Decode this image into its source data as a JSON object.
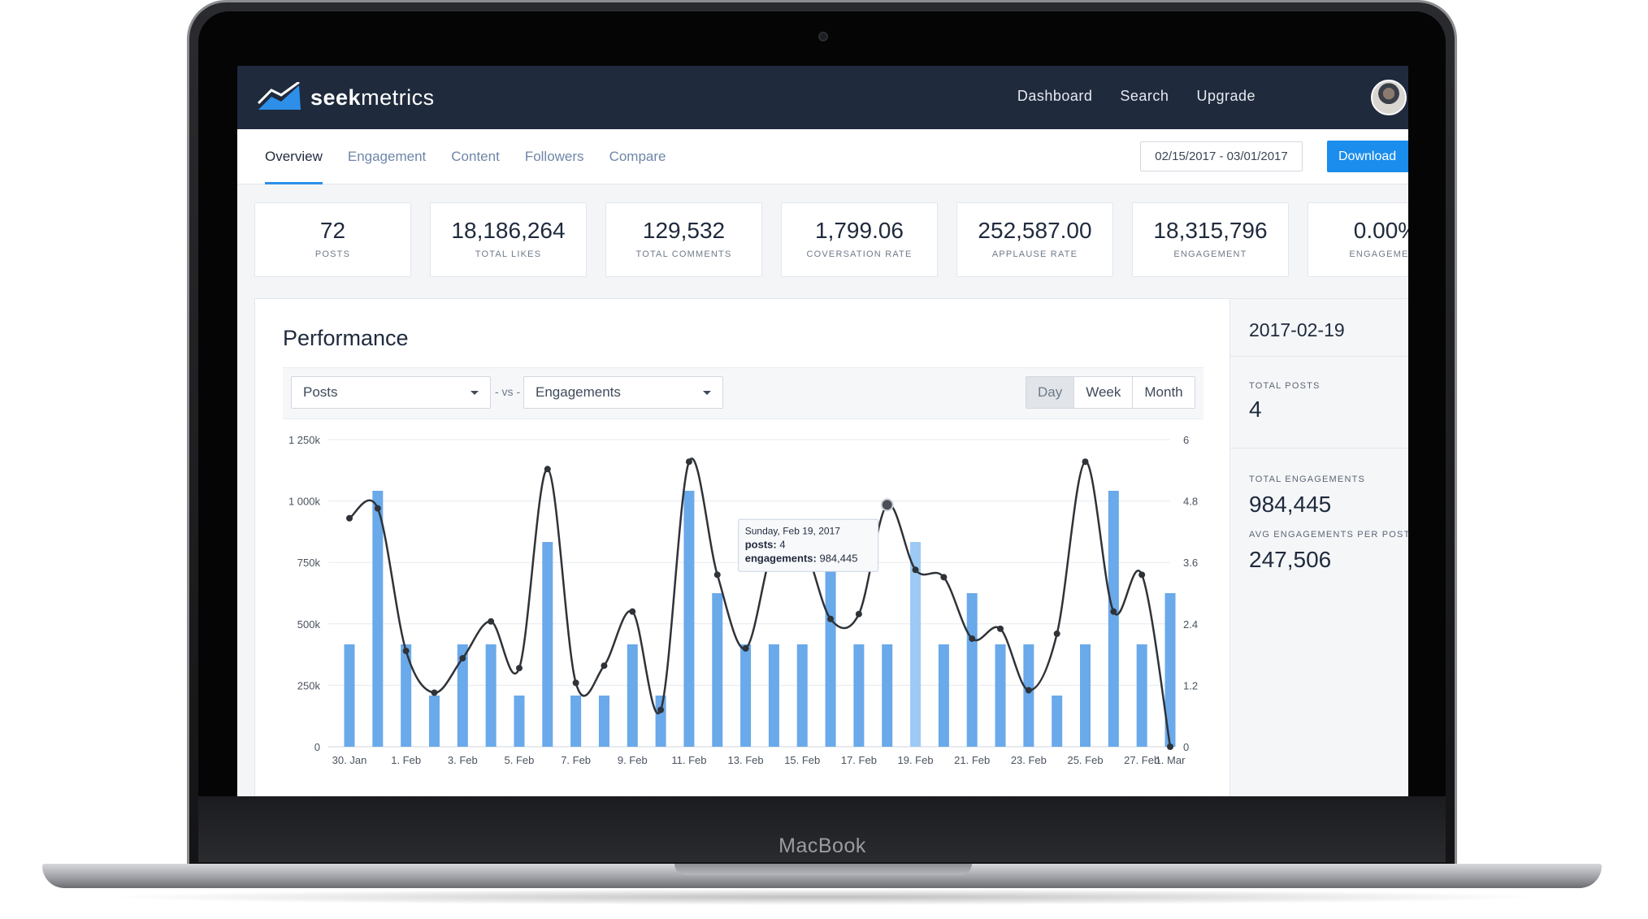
{
  "device": {
    "brand_label": "MacBook"
  },
  "app": {
    "logo_bold": "seek",
    "logo_light": "metrics"
  },
  "topnav": {
    "links": [
      "Dashboard",
      "Search",
      "Upgrade"
    ]
  },
  "subnav": {
    "tabs": [
      "Overview",
      "Engagement",
      "Content",
      "Followers",
      "Compare"
    ],
    "active_tab": "Overview",
    "date_range": "02/15/2017 - 03/01/2017",
    "download_label": "Download"
  },
  "stats": [
    {
      "value": "72",
      "label": "POSTS"
    },
    {
      "value": "18,186,264",
      "label": "TOTAL LIKES"
    },
    {
      "value": "129,532",
      "label": "TOTAL COMMENTS"
    },
    {
      "value": "1,799.06",
      "label": "COVERSATION RATE"
    },
    {
      "value": "252,587.00",
      "label": "APPLAUSE RATE"
    },
    {
      "value": "18,315,796",
      "label": "ENGAGEMENT"
    },
    {
      "value": "0.00%",
      "label": "ENGAGEMENT"
    }
  ],
  "performance": {
    "title": "Performance",
    "select_left": "Posts",
    "vs_label": "- vs -",
    "select_right": "Engagements",
    "periods": [
      "Day",
      "Week",
      "Month"
    ],
    "active_period": "Day"
  },
  "tooltip": {
    "date": "Sunday, Feb 19, 2017",
    "posts_label": "posts:",
    "posts_value": "4",
    "engagements_label": "engagements:",
    "engagements_value": "984,445"
  },
  "side_panel": {
    "date": "2017-02-19",
    "total_posts_label": "TOTAL POSTS",
    "total_posts_value": "4",
    "total_engagements_label": "TOTAL ENGAGEMENTS",
    "total_engagements_value": "984,445",
    "avg_label": "AVG ENGAGEMENTS PER POST",
    "avg_value": "247,506"
  },
  "colors": {
    "bar": "#6aa9ea",
    "bar_highlight": "#9ccaf5",
    "line": "#2f3338",
    "nav_bg": "#1f2a3d",
    "accent": "#1a8ded"
  },
  "chart_data": {
    "type": "bar",
    "x_tick_labels": [
      "30. Jan",
      "1. Feb",
      "3. Feb",
      "5. Feb",
      "7. Feb",
      "9. Feb",
      "11. Feb",
      "13. Feb",
      "15. Feb",
      "17. Feb",
      "19. Feb",
      "21. Feb",
      "23. Feb",
      "25. Feb",
      "27. Feb",
      "1. Mar"
    ],
    "y_left_ticks": [
      "0",
      "250k",
      "500k",
      "750k",
      "1 000k",
      "1 250k"
    ],
    "y_right_ticks": [
      "0",
      "1.2",
      "2.4",
      "3.6",
      "4.8",
      "6"
    ],
    "ylim_left": [
      0,
      1250000
    ],
    "ylim_right": [
      0,
      6
    ],
    "highlight_index": 20,
    "series": [
      {
        "name": "posts",
        "axis": "right",
        "type": "bar",
        "values": [
          2,
          5,
          2,
          1,
          2,
          2,
          1,
          4,
          1,
          1,
          2,
          1,
          5,
          3,
          2,
          2,
          2,
          4,
          2,
          2,
          4,
          2,
          3,
          2,
          2,
          1,
          2,
          5,
          2,
          3
        ]
      },
      {
        "name": "engagements",
        "axis": "left",
        "type": "line",
        "values": [
          930000,
          970000,
          390000,
          220000,
          360000,
          510000,
          320000,
          1130000,
          260000,
          330000,
          550000,
          150000,
          1160000,
          700000,
          400000,
          820000,
          830000,
          520000,
          540000,
          984445,
          720000,
          690000,
          440000,
          480000,
          230000,
          460000,
          1160000,
          550000,
          700000,
          0
        ]
      }
    ]
  }
}
